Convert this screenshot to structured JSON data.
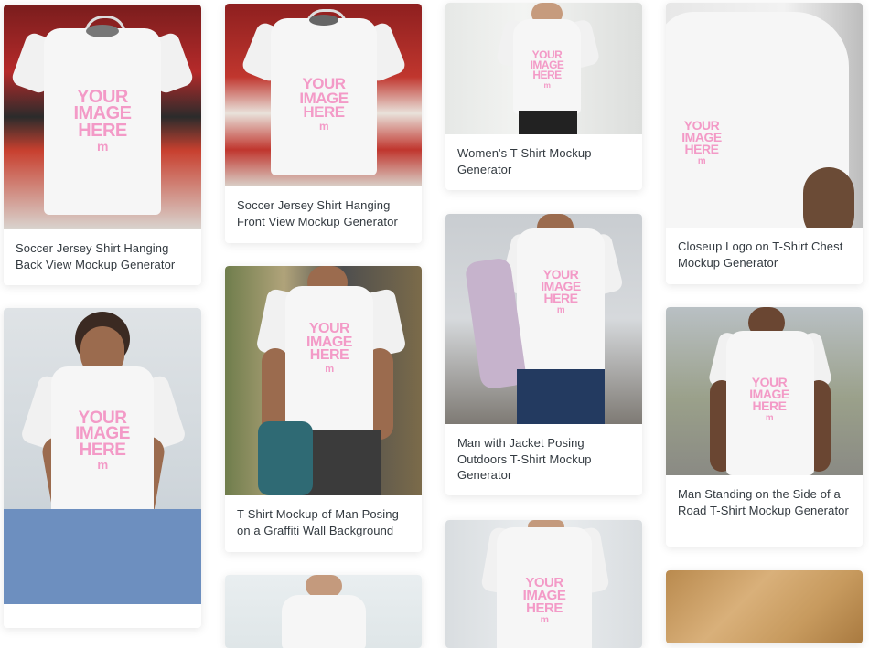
{
  "watermark": {
    "line1": "YOUR",
    "line2": "IMAGE",
    "line3": "HERE",
    "mark": "m"
  },
  "colors": {
    "watermark": "#f39ac7",
    "caption_text": "#333a40",
    "card_bg": "#ffffff"
  },
  "cards": [
    {
      "title": "Soccer Jersey Shirt Hanging Back View Mockup Generator"
    },
    {
      "title": ""
    },
    {
      "title": "Soccer Jersey Shirt Hanging Front View Mockup Generator"
    },
    {
      "title": "T-Shirt Mockup of Man Posing on a Graffiti Wall Background"
    },
    {
      "title": ""
    },
    {
      "title": "Women's T-Shirt Mockup Generator"
    },
    {
      "title": "Man with Jacket Posing Outdoors T-Shirt Mockup Generator"
    },
    {
      "title": ""
    },
    {
      "title": "Closeup Logo on T-Shirt Chest Mockup Generator"
    },
    {
      "title": "Man Standing on the Side of a Road T-Shirt Mockup Generator"
    },
    {
      "title": ""
    }
  ]
}
